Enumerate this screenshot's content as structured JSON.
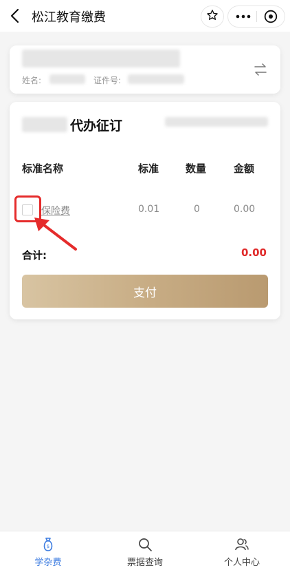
{
  "header": {
    "title": "松江教育缴费"
  },
  "student": {
    "name_label": "姓名:",
    "id_label": "证件号:"
  },
  "order": {
    "title_suffix": "代办征订",
    "columns": {
      "name": "标准名称",
      "standard": "标准",
      "quantity": "数量",
      "amount": "金额"
    },
    "items": [
      {
        "name": "保险费",
        "standard": "0.01",
        "quantity": "0",
        "amount": "0.00",
        "checked": false
      }
    ],
    "total_label": "合计:",
    "total_value": "0.00",
    "pay_label": "支付"
  },
  "tabs": [
    {
      "label": "学杂费",
      "icon": "money-bag-icon",
      "active": true
    },
    {
      "label": "票据查询",
      "icon": "search-icon",
      "active": false
    },
    {
      "label": "个人中心",
      "icon": "user-icon",
      "active": false
    }
  ],
  "colors": {
    "accent": "#3b7be0",
    "total_red": "#e02b2b",
    "pay_gold": "#c8ad85",
    "highlight_red": "#e52b2b"
  }
}
